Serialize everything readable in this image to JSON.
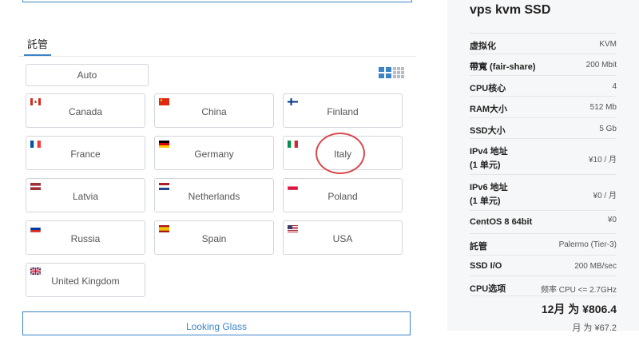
{
  "location": {
    "tab_label": "託管",
    "auto_label": "Auto",
    "locations": [
      {
        "name": "Canada",
        "flag": "flag-canada"
      },
      {
        "name": "China",
        "flag": "flag-china"
      },
      {
        "name": "Finland",
        "flag": "flag-finland"
      },
      {
        "name": "France",
        "flag": "flag-france"
      },
      {
        "name": "Germany",
        "flag": "flag-germany"
      },
      {
        "name": "Italy",
        "flag": "flag-italy"
      },
      {
        "name": "Latvia",
        "flag": "flag-latvia"
      },
      {
        "name": "Netherlands",
        "flag": "flag-netherlands"
      },
      {
        "name": "Poland",
        "flag": "flag-poland"
      },
      {
        "name": "Russia",
        "flag": "flag-russia"
      },
      {
        "name": "Spain",
        "flag": "flag-spain"
      },
      {
        "name": "USA",
        "flag": "flag-usa"
      },
      {
        "name": "United Kingdom",
        "flag": "flag-uk"
      }
    ],
    "looking_glass_label": "Looking Glass",
    "view_toggle_icons": [
      "large-grid-icon",
      "small-grid-icon"
    ]
  },
  "summary": {
    "title": "vps kvm SSD",
    "specs": [
      {
        "key": "虚拟化",
        "value": "KVM"
      },
      {
        "key": "帶寬 (fair-share)",
        "value": "200 Mbit"
      },
      {
        "key": "CPU核心",
        "value": "4"
      },
      {
        "key": "RAM大小",
        "value": "512 Mb"
      },
      {
        "key": "SSD大小",
        "value": "5 Gb"
      },
      {
        "key_line1": "IPv4 地址",
        "key_line2": "(1 单元)",
        "value": "¥10 / 月"
      },
      {
        "key_line1": "IPv6 地址",
        "key_line2": "(1 单元)",
        "value": "¥0 / 月"
      },
      {
        "key": "CentOS 8 64bit",
        "value": "¥0"
      },
      {
        "key": "託管",
        "value": "Palermo (Tier-3)"
      },
      {
        "key": "SSD I/O",
        "value": "200 MB/sec"
      },
      {
        "key": "CPU选项",
        "value": "频率 CPU <= 2.7GHz"
      }
    ],
    "total_main": "12月 为 ¥806.4",
    "total_sub": "月 为 ¥67.2"
  },
  "colors": {
    "accent": "#3d84c6",
    "highlight_circle": "#d9494f",
    "panel_bg": "#f6f7f8"
  }
}
